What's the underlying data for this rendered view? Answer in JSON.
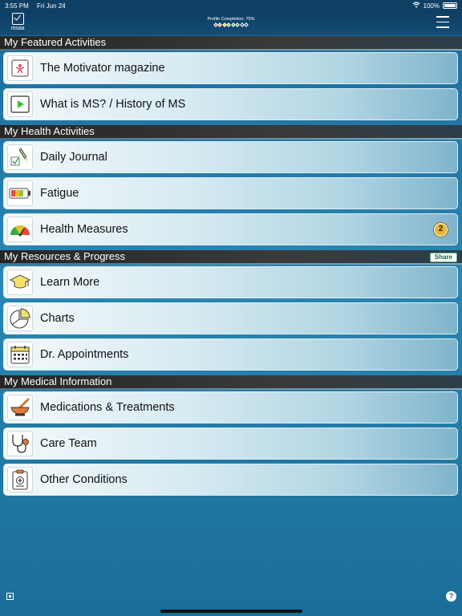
{
  "status": {
    "time": "3:55 PM",
    "date": "Fri Jun 24",
    "battery": "100%"
  },
  "header": {
    "logo_text": "msaa",
    "profile_completion": "Profile Completion: 75%",
    "diamond_colors": [
      "#e04040",
      "#e08a2a",
      "#e0c42a",
      "#7ac04a",
      "#3aa84a",
      "#2a9a4a",
      "transparent",
      "transparent"
    ]
  },
  "sections": {
    "featured": "My Featured Activities",
    "health": "My Health Activities",
    "resources": "My Resources & Progress",
    "medical": "My Medical Information"
  },
  "share_label": "Share",
  "rows": {
    "motivator": "The Motivator magazine",
    "history": "What is MS? / History of MS",
    "journal": "Daily Journal",
    "fatigue": "Fatigue",
    "measures": "Health Measures",
    "measures_badge": "2",
    "learn": "Learn More",
    "charts": "Charts",
    "appointments": "Dr. Appointments",
    "medications": "Medications & Treatments",
    "careteam": "Care Team",
    "conditions": "Other Conditions"
  },
  "help_symbol": "?"
}
